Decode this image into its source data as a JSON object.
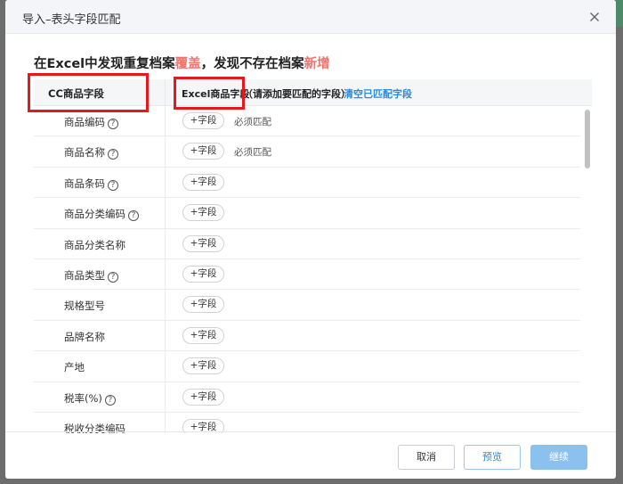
{
  "dialog": {
    "title": "导入–表头字段匹配",
    "close_icon": "close-icon"
  },
  "hint": {
    "part1": "在Excel中发现重复档案",
    "overwrite": "覆盖",
    "part2": "，发现不存在档案",
    "new": "新增"
  },
  "table": {
    "col_left": "CC商品字段",
    "col_right_title": "Excel商品字段",
    "col_right_note": "（请添加要匹配的字段）",
    "clear_link": "清空已匹配字段",
    "add_label": "+字段",
    "rows": [
      {
        "name": "商品编码",
        "help": true,
        "required": "必须匹配"
      },
      {
        "name": "商品名称",
        "help": true,
        "required": "必须匹配"
      },
      {
        "name": "商品条码",
        "help": true,
        "required": ""
      },
      {
        "name": "商品分类编码",
        "help": true,
        "required": ""
      },
      {
        "name": "商品分类名称",
        "help": false,
        "required": ""
      },
      {
        "name": "商品类型",
        "help": true,
        "required": ""
      },
      {
        "name": "规格型号",
        "help": false,
        "required": ""
      },
      {
        "name": "品牌名称",
        "help": false,
        "required": ""
      },
      {
        "name": "产地",
        "help": false,
        "required": ""
      },
      {
        "name": "税率(%)",
        "help": true,
        "required": ""
      },
      {
        "name": "税收分类编码",
        "help": false,
        "required": ""
      }
    ]
  },
  "footer": {
    "cancel": "取消",
    "preview": "预览",
    "continue": "继续"
  },
  "colors": {
    "accent_red": "#f0736e",
    "link_blue": "#2a8bd9",
    "primary_button": "#8cc0ee",
    "annotation_red": "#e6191a"
  }
}
